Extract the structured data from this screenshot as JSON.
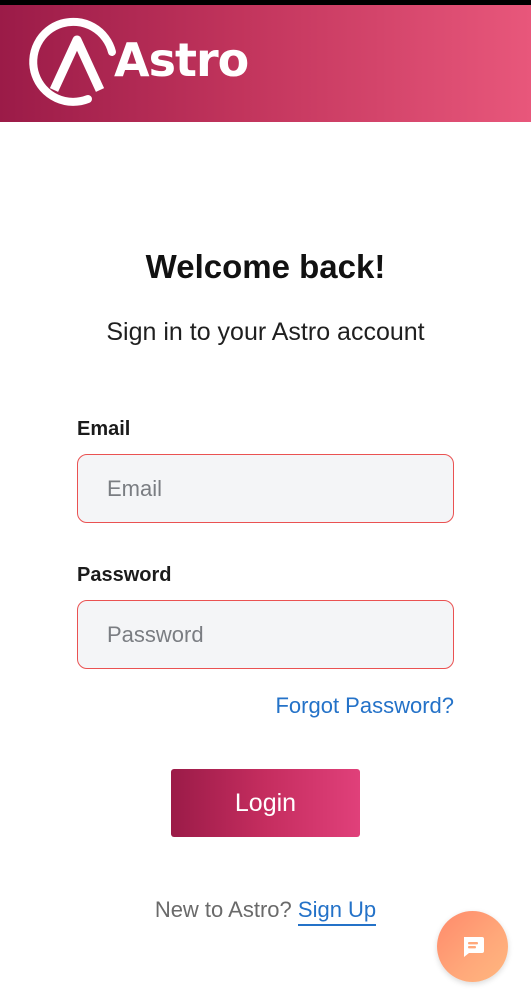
{
  "header": {
    "brand": "Astro",
    "colors": {
      "gradient_start": "#9b1b48",
      "gradient_end": "#e8577b"
    }
  },
  "welcome": {
    "title": "Welcome back!",
    "subtitle": "Sign in to your Astro account"
  },
  "form": {
    "email_label": "Email",
    "email_placeholder": "Email",
    "password_label": "Password",
    "password_placeholder": "Password",
    "forgot_password": "Forgot Password?",
    "login_button": "Login"
  },
  "signup": {
    "prompt": "New to Astro?",
    "link": "Sign Up"
  },
  "chat": {
    "icon": "chat-bubble-icon",
    "color": "#ff9a75"
  }
}
